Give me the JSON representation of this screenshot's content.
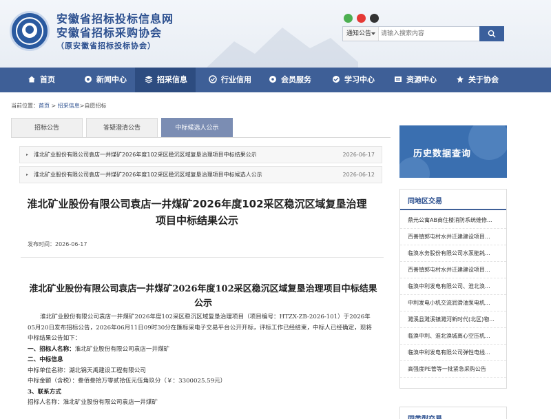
{
  "header": {
    "title": "安徽省招标投标信息网",
    "subtitle": "安徽省招标采购协会",
    "note": "（原安徽省招标投标协会）"
  },
  "social_icons": [
    "wechat-icon",
    "weibo-icon",
    "qq-icon"
  ],
  "search": {
    "category": "通知公告",
    "placeholder": "请输入搜索内容"
  },
  "nav": {
    "items": [
      {
        "label": "首页",
        "icon": "home-icon"
      },
      {
        "label": "新闻中心",
        "icon": "news-icon"
      },
      {
        "label": "招采信息",
        "icon": "layers-icon"
      },
      {
        "label": "行业信用",
        "icon": "credit-icon"
      },
      {
        "label": "会员服务",
        "icon": "members-icon"
      },
      {
        "label": "学习中心",
        "icon": "learn-icon"
      },
      {
        "label": "资源中心",
        "icon": "resource-icon"
      },
      {
        "label": "关于协会",
        "icon": "about-icon"
      }
    ],
    "active_color": "#2d4c80",
    "bar_color": "#3e5f97"
  },
  "breadcrumb": {
    "prefix": "当前位置：",
    "home": "首页",
    "sep": " > ",
    "section": "招采信息",
    "current": ">自愿招标"
  },
  "tabs": [
    "招标公告",
    "答疑澄清公告",
    "中标候选人公示"
  ],
  "related": [
    {
      "title": "淮北矿业股份有限公司袁店一井煤矿2026年度102采区稳沉区域复垦治理项目中标结果公示",
      "date": "2026-06-17"
    },
    {
      "title": "淮北矿业股份有限公司袁店一井煤矿2026年度102采区稳沉区域复垦治理项目中标候选人公示",
      "date": "2026-06-12"
    }
  ],
  "article": {
    "title": "淮北矿业股份有限公司袁店一井煤矿2026年度102采区稳沉区域复垦治理项目中标结果公示",
    "pubdate": "发布时间：2026-06-17",
    "doc_title": "淮北矿业股份有限公司袁店一井煤矿2026年度102采区稳沉区域复垦治理项目中标结果公示",
    "intro": "淮北矿业股份有限公司袁店一井煤矿2026年度102采区稳沉区域复垦治理项目（项目编号：HTZX-ZB-2026-101）于2026年05月20日发布招标公告，2026年06月11日09时30分在匯标采电子交易平台公开开标，评标工作已经结束，中标人已经确定，现将中标结果公告如下：",
    "s1_label": "一、招标人名称：",
    "s1_value": "淮北矿业股份有限公司袁店一井煤矿",
    "s2_label": "二、中标信息",
    "winner": "中标单位名称：湖北锦天禹建设工程有限公司",
    "amount": "中标金额（含税）：叁佰叁拾万零贰拾伍元伍角玖分（￥：3300025.59元）",
    "s3_label": "3、联系方式",
    "contact": "招标人名称：淮北矿业股份有限公司袁店一井煤矿"
  },
  "sidebar": {
    "history_label": "历史数据查询",
    "section1": "同地区交易",
    "items": [
      "鼎元公寓AB商住楼消防系统维修...",
      "百善镇郭屯村水井迁建建设项目...",
      "临涣水务股份有限公司水泵能耗...",
      "百善镇郭屯村水井迁建建设项目...",
      "临涣中利发电有限公司、淮北涣...",
      "中利发电小机交流润滑油泵电机...",
      "濉溪县濉溪镇濉河新时代(北区)物...",
      "临涣中利、淮北涣城离心空压机...",
      "临涣中利发电有限公司弹性电线...",
      "高强度PE管等一批紧急采购公告"
    ],
    "section2": "同类型交易"
  }
}
